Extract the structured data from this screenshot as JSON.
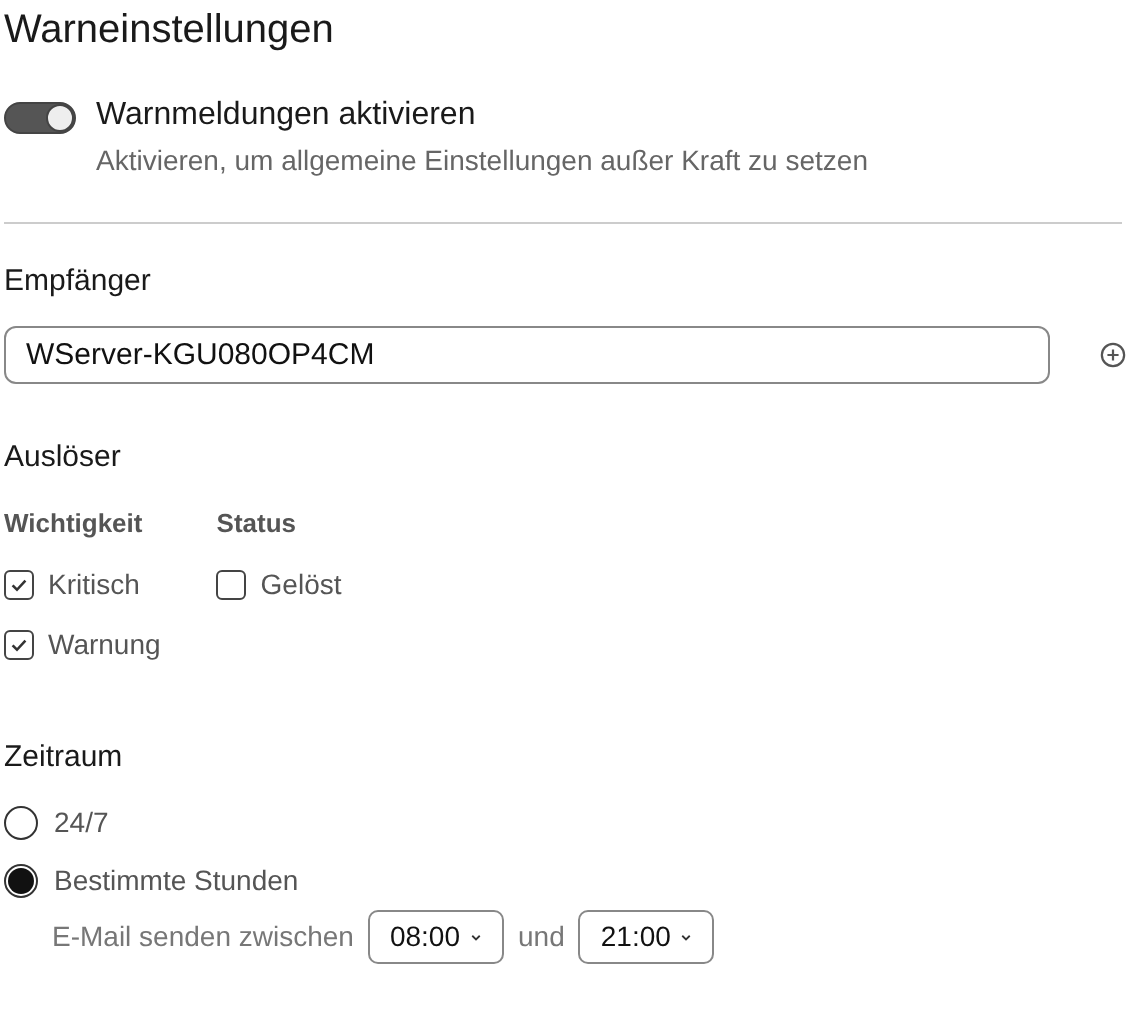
{
  "title": "Warneinstellungen",
  "toggle": {
    "label": "Warnmeldungen aktivieren",
    "description": "Aktivieren, um allgemeine Einstellungen außer Kraft zu setzen",
    "on": true
  },
  "recipients": {
    "heading": "Empfänger",
    "value": "WServer-KGU080OP4CM"
  },
  "triggers": {
    "heading": "Auslöser",
    "groups": [
      {
        "heading": "Wichtigkeit",
        "items": [
          {
            "label": "Kritisch",
            "checked": true
          },
          {
            "label": "Warnung",
            "checked": true
          }
        ]
      },
      {
        "heading": "Status",
        "items": [
          {
            "label": "Gelöst",
            "checked": false
          }
        ]
      }
    ]
  },
  "period": {
    "heading": "Zeitraum",
    "options": [
      {
        "label": "24/7",
        "selected": false
      },
      {
        "label": "Bestimmte Stunden",
        "selected": true
      }
    ],
    "between": {
      "prefix": "E-Mail senden zwischen",
      "from": "08:00",
      "joiner": "und",
      "to": "21:00"
    }
  }
}
